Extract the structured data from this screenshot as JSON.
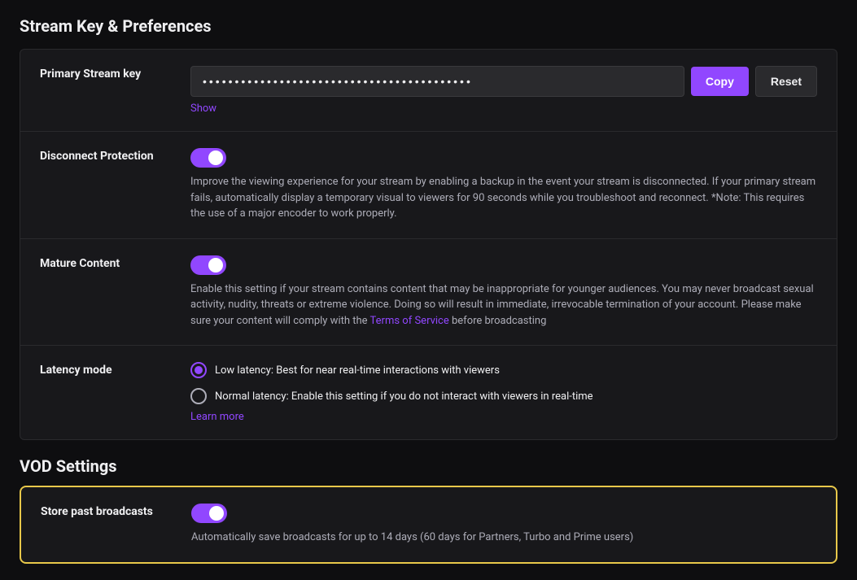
{
  "page": {
    "title": "Stream Key & Preferences",
    "vod_title": "VOD Settings"
  },
  "stream_key": {
    "label": "Primary Stream key",
    "value": "••••••••••••••••••••••••••••••••••••••••••",
    "copy_button": "Copy",
    "reset_button": "Reset",
    "show_link": "Show"
  },
  "disconnect_protection": {
    "label": "Disconnect Protection",
    "enabled": true,
    "description": "Improve the viewing experience for your stream by enabling a backup in the event your stream is disconnected. If your primary stream fails, automatically display a temporary visual to viewers for 90 seconds while you troubleshoot and reconnect. *Note: This requires the use of a major encoder to work properly."
  },
  "mature_content": {
    "label": "Mature Content",
    "enabled": true,
    "description_part1": "Enable this setting if your stream contains content that may be inappropriate for younger audiences. You may never broadcast sexual activity, nudity, threats or extreme violence. Doing so will result in immediate, irrevocable termination of your account. Please make sure your content will comply with the ",
    "tos_link_text": "Terms of Service",
    "description_part2": " before broadcasting"
  },
  "latency_mode": {
    "label": "Latency mode",
    "options": [
      {
        "id": "low",
        "label": "Low latency: Best for near real-time interactions with viewers",
        "selected": true
      },
      {
        "id": "normal",
        "label": "Normal latency: Enable this setting if you do not interact with viewers in real-time",
        "selected": false
      }
    ],
    "learn_more": "Learn more"
  },
  "store_broadcasts": {
    "label": "Store past broadcasts",
    "enabled": true,
    "description": "Automatically save broadcasts for up to 14 days (60 days for Partners, Turbo and Prime users)"
  }
}
